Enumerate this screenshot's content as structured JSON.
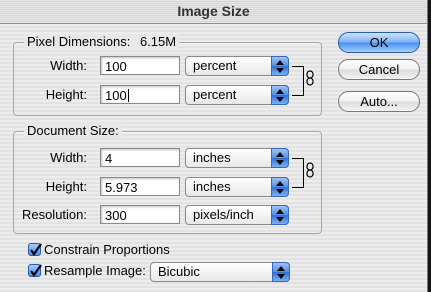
{
  "window": {
    "title": "Image Size"
  },
  "pixel_dimensions": {
    "label": "Pixel Dimensions:",
    "size": "6.15M",
    "width_label": "Width:",
    "width_value": "100",
    "width_unit": "percent",
    "height_label": "Height:",
    "height_value": "100",
    "height_unit": "percent"
  },
  "document_size": {
    "label": "Document Size:",
    "width_label": "Width:",
    "width_value": "4",
    "width_unit": "inches",
    "height_label": "Height:",
    "height_value": "5.973",
    "height_unit": "inches",
    "resolution_label": "Resolution:",
    "resolution_value": "300",
    "resolution_unit": "pixels/inch"
  },
  "options": {
    "constrain_label": "Constrain Proportions",
    "constrain_checked": true,
    "resample_label": "Resample Image:",
    "resample_checked": true,
    "resample_method": "Bicubic"
  },
  "buttons": {
    "ok": "OK",
    "cancel": "Cancel",
    "auto": "Auto..."
  },
  "icons": {
    "link": "chain-link-icon",
    "check": "checkmark-icon",
    "popup": "up-down-arrows-icon"
  },
  "colors": {
    "accent": "#4a8ff0",
    "background": "#ececec"
  }
}
